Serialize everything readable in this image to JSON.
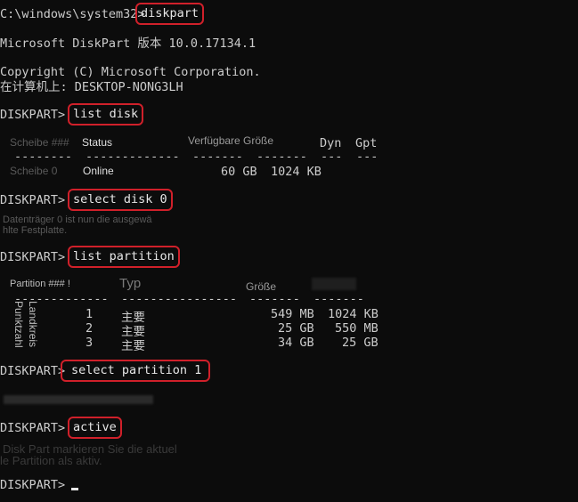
{
  "terminal": {
    "initial_prompt": "C:\\windows\\system32>",
    "initial_command": "diskpart",
    "version_line": "Microsoft DiskPart 版本 10.0.17134.1",
    "copyright_line": "Copyright (C) Microsoft Corporation.",
    "computer_line": "在计算机上: DESKTOP-NONG3LH",
    "prompt": "DISKPART>",
    "commands": {
      "list_disk": "list disk",
      "select_disk": "select disk 0",
      "list_partition": "list partition",
      "select_partition": "select partition 1",
      "active": "active"
    },
    "disk_table": {
      "headers": [
        "Scheibe ###",
        "Status",
        "Verfügbare Größe",
        "Dyn",
        "Gpt"
      ],
      "separators": [
        "--------",
        "-------------",
        "-------",
        "-------",
        "---",
        "---"
      ],
      "rows": [
        {
          "disk": "Scheibe 0",
          "status": "Online",
          "size": "60 GB",
          "free": "1024 KB",
          "dyn": "",
          "gpt": ""
        }
      ]
    },
    "select_disk_output": [
      "Datenträger 0 ist nun die ausgewä",
      "hlte Festplatte."
    ],
    "partition_table": {
      "headers": [
        "Partition ### !",
        "Typ",
        "Größe",
        ""
      ],
      "separators": [
        "-------------",
        "----------------",
        "-------",
        "-------"
      ],
      "vertical_labels": [
        "Landkreis",
        "Punktzahl"
      ],
      "rows": [
        {
          "num": "1",
          "type": "主要",
          "size": "549 MB",
          "offset": "1024 KB"
        },
        {
          "num": "2",
          "type": "主要",
          "size": "25 GB",
          "offset": "550 MB"
        },
        {
          "num": "3",
          "type": "主要",
          "size": "34 GB",
          "offset": "25 GB"
        }
      ]
    },
    "active_output": [
      "Disk Part markieren Sie die aktuel",
      "le Partition als aktiv."
    ],
    "final_prompt": "DISKPART>"
  },
  "colors": {
    "background": "#0c0c0c",
    "text": "#cccccc",
    "highlight_border": "#d0202a"
  }
}
